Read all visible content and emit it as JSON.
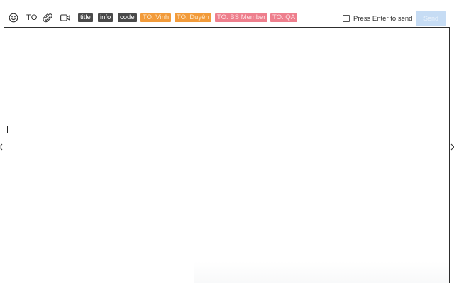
{
  "toolbar": {
    "to_label": "TO",
    "tags": [
      {
        "label": "title",
        "style": "dark"
      },
      {
        "label": "info",
        "style": "dark"
      },
      {
        "label": "code",
        "style": "dark"
      },
      {
        "label": "TO: Vinh",
        "style": "orange"
      },
      {
        "label": "TO: Duyên",
        "style": "orange"
      },
      {
        "label": "TO: BS Member",
        "style": "pink"
      },
      {
        "label": "TO: QA",
        "style": "pink"
      }
    ],
    "press_enter_label": "Press Enter to send",
    "press_enter_checked": false,
    "send_label": "Send"
  },
  "icons": {
    "emoji": "smile-icon",
    "attach": "paperclip-icon",
    "video": "video-camera-icon"
  },
  "colors": {
    "tag_dark": "#4a4a4a",
    "tag_orange": "#f29b3a",
    "tag_pink": "#ee7f8d",
    "send_button": "#c6dcf4"
  },
  "message": {
    "value": "",
    "placeholder": ""
  }
}
